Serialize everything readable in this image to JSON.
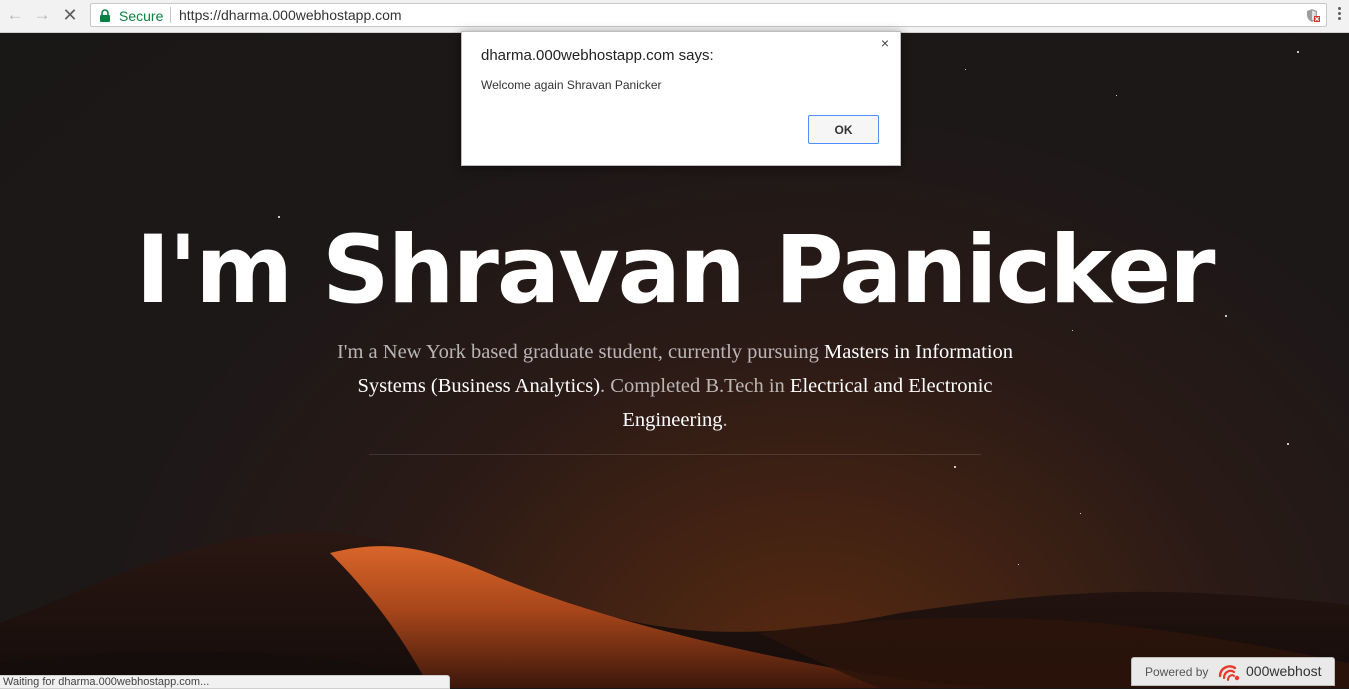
{
  "browser": {
    "secure_label": "Secure",
    "url": "https://dharma.000webhostapp.com"
  },
  "hero": {
    "title": "I'm Shravan Panicker",
    "subtitle_parts": [
      {
        "text": "I'm a New York based graduate student, currently pursuing ",
        "highlight": false
      },
      {
        "text": "Masters in Information Systems (Business Analytics)",
        "highlight": true
      },
      {
        "text": ". Completed B.Tech in ",
        "highlight": false
      },
      {
        "text": "Electrical and Electronic Engineering",
        "highlight": true
      },
      {
        "text": ".",
        "highlight": false
      }
    ]
  },
  "dialog": {
    "title": "dharma.000webhostapp.com says:",
    "message": "Welcome again Shravan Panicker",
    "ok_label": "OK",
    "close_symbol": "×"
  },
  "status": {
    "text": "Waiting for dharma.000webhostapp.com..."
  },
  "powered": {
    "label": "Powered by",
    "brand": "000webhost"
  },
  "icons": {
    "back": "back-arrow-icon",
    "forward": "forward-arrow-icon",
    "stop": "stop-icon",
    "lock": "lock-icon",
    "shield": "shield-icon",
    "menu": "menu-icon",
    "logo": "000webhost-logo-icon"
  },
  "colors": {
    "secure": "#0b8043",
    "highlight": "#ffffff",
    "ok_border": "#4d90fe",
    "dune": "#c2561c"
  }
}
